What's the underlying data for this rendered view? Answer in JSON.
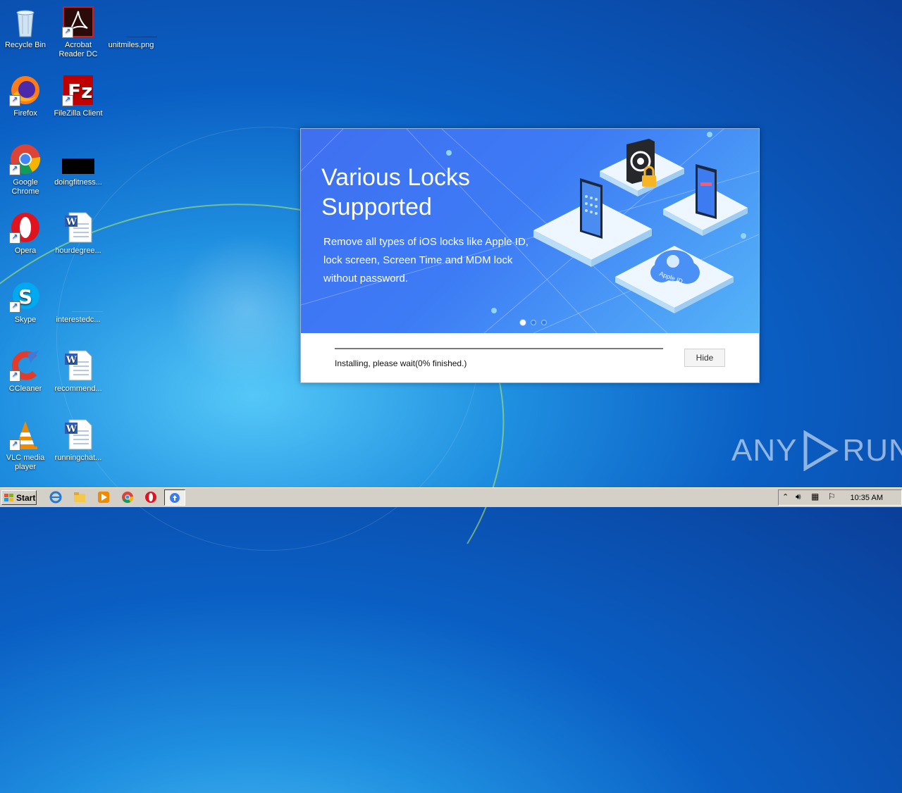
{
  "desktop_icons": [
    {
      "label": "Recycle Bin"
    },
    {
      "label": "Acrobat Reader DC"
    },
    {
      "label": "unitmiles.png"
    },
    {
      "label": "Firefox"
    },
    {
      "label": "FileZilla Client"
    },
    {
      "label": "Google Chrome"
    },
    {
      "label": "doingfitness..."
    },
    {
      "label": "Opera"
    },
    {
      "label": "hourdegree..."
    },
    {
      "label": "Skype"
    },
    {
      "label": "interestedc..."
    },
    {
      "label": "CCleaner"
    },
    {
      "label": "recommend..."
    },
    {
      "label": "VLC media player"
    },
    {
      "label": "runningchat..."
    }
  ],
  "dialog": {
    "banner_title": "Various Locks Supported",
    "banner_desc": "Remove all types of iOS locks like Apple ID, lock screen, Screen Time and MDM lock without password.",
    "apple_id_badge": "Apple ID",
    "carousel_active_index": 0,
    "progress_fraction": 0.0,
    "status_text": "Installing, please wait(0% finished.)",
    "hide_label": "Hide"
  },
  "taskbar": {
    "start_label": "Start",
    "clock": "10:35 AM"
  },
  "watermark": {
    "text_left": "ANY",
    "text_right": "RUN"
  },
  "colors": {
    "banner_start": "#3f6ff0",
    "banner_end": "#55b4f7",
    "accent": "#3a7bf2"
  }
}
